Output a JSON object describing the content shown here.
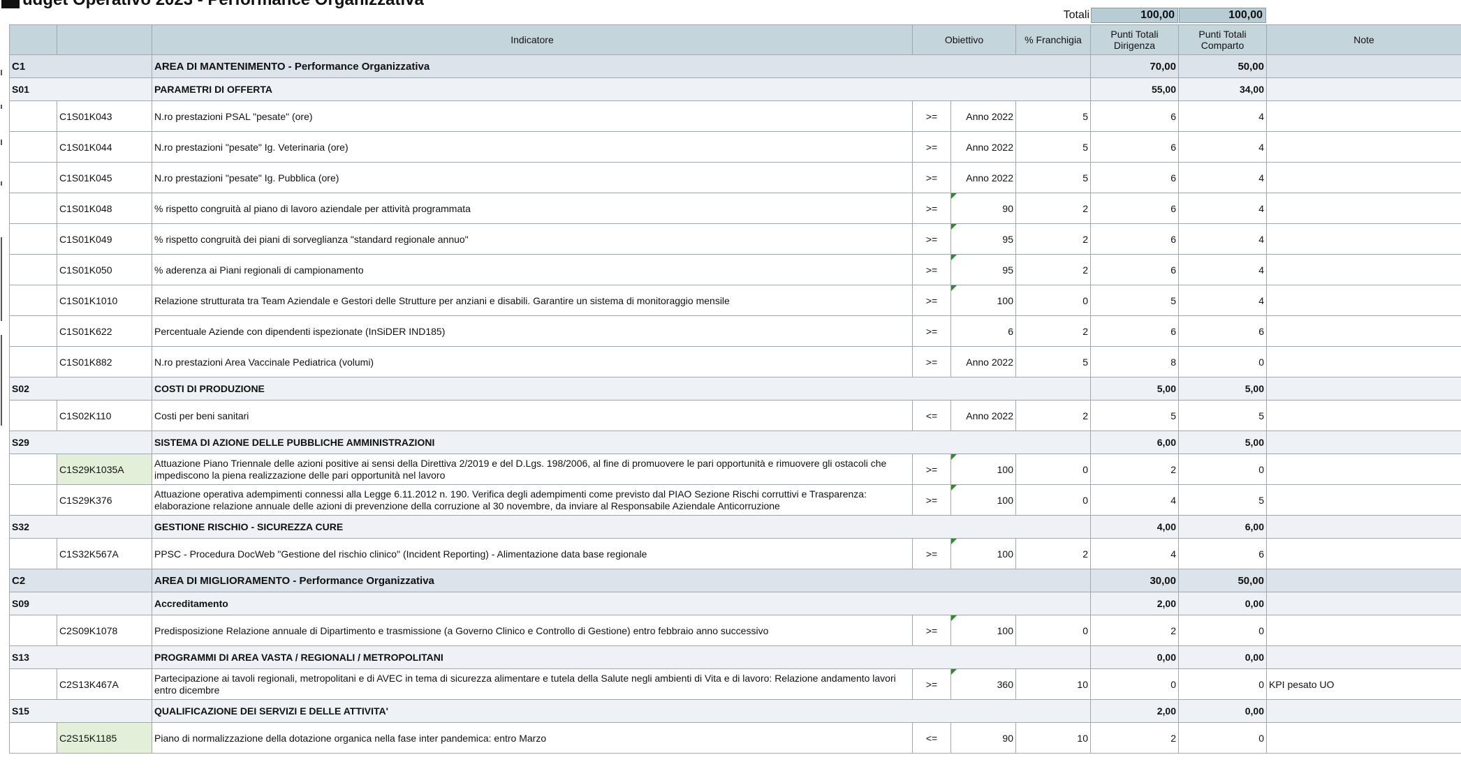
{
  "title": "udget Operativo 2023 - Performance Organizzativa",
  "totals": {
    "label": "Totali",
    "dirigenza": "100,00",
    "comparto": "100,00"
  },
  "headers": {
    "code": "",
    "sub": "",
    "indicatore": "Indicatore",
    "obiettivo": "Obiettivo",
    "franchigia": "% Franchigia",
    "dirigenza": "Punti Totali Dirigenza",
    "comparto": "Punti Totali Comparto",
    "note": "Note"
  },
  "rows": [
    {
      "type": "area",
      "code": "C1",
      "title": "AREA DI MANTENIMENTO - Performance Organizzativa",
      "dir": "70,00",
      "comp": "50,00"
    },
    {
      "type": "sec",
      "code": "S01",
      "title": "PARAMETRI DI OFFERTA",
      "dir": "55,00",
      "comp": "34,00"
    },
    {
      "type": "item",
      "id": "C1S01K043",
      "desc": "N.ro prestazioni PSAL  \"pesate\" (ore)",
      "op": ">=",
      "obj": "Anno 2022",
      "fr": "5",
      "dir": "6",
      "comp": "4",
      "note": "",
      "flag": false,
      "green": false
    },
    {
      "type": "item",
      "id": "C1S01K044",
      "desc": "N.ro prestazioni \"pesate\" Ig. Veterinaria (ore)",
      "op": ">=",
      "obj": "Anno 2022",
      "fr": "5",
      "dir": "6",
      "comp": "4",
      "note": "",
      "flag": false,
      "green": false
    },
    {
      "type": "item",
      "id": "C1S01K045",
      "desc": "N.ro prestazioni \"pesate\" Ig. Pubblica (ore)",
      "op": ">=",
      "obj": "Anno 2022",
      "fr": "5",
      "dir": "6",
      "comp": "4",
      "note": "",
      "flag": false,
      "green": false
    },
    {
      "type": "item",
      "id": "C1S01K048",
      "desc": "% rispetto congruità al piano di lavoro aziendale per attività programmata",
      "op": ">=",
      "obj": "90",
      "fr": "2",
      "dir": "6",
      "comp": "4",
      "note": "",
      "flag": true,
      "green": false
    },
    {
      "type": "item",
      "id": "C1S01K049",
      "desc": "% rispetto congruità dei piani di sorveglianza \"standard regionale annuo\"",
      "op": ">=",
      "obj": "95",
      "fr": "2",
      "dir": "6",
      "comp": "4",
      "note": "",
      "flag": true,
      "green": false
    },
    {
      "type": "item",
      "id": "C1S01K050",
      "desc": "% aderenza ai Piani regionali di campionamento",
      "op": ">=",
      "obj": "95",
      "fr": "2",
      "dir": "6",
      "comp": "4",
      "note": "",
      "flag": true,
      "green": false
    },
    {
      "type": "item",
      "id": "C1S01K1010",
      "desc": "Relazione strutturata tra Team Aziendale e Gestori delle Strutture per anziani e disabili. Garantire un sistema di monitoraggio mensile",
      "op": ">=",
      "obj": "100",
      "fr": "0",
      "dir": "5",
      "comp": "4",
      "note": "",
      "flag": true,
      "green": false
    },
    {
      "type": "item",
      "id": "C1S01K622",
      "desc": "Percentuale Aziende con dipendenti ispezionate (InSiDER IND185)",
      "op": ">=",
      "obj": "6",
      "fr": "2",
      "dir": "6",
      "comp": "6",
      "note": "",
      "flag": false,
      "green": false
    },
    {
      "type": "item",
      "id": "C1S01K882",
      "desc": "N.ro prestazioni Area Vaccinale Pediatrica (volumi)",
      "op": ">=",
      "obj": "Anno 2022",
      "fr": "5",
      "dir": "8",
      "comp": "0",
      "note": "",
      "flag": false,
      "green": false
    },
    {
      "type": "sec",
      "code": "S02",
      "title": "COSTI DI PRODUZIONE",
      "dir": "5,00",
      "comp": "5,00"
    },
    {
      "type": "item",
      "id": "C1S02K110",
      "desc": "Costi per beni sanitari",
      "op": "<=",
      "obj": "Anno 2022",
      "fr": "2",
      "dir": "5",
      "comp": "5",
      "note": "",
      "flag": false,
      "green": false
    },
    {
      "type": "sec",
      "code": "S29",
      "title": "SISTEMA DI AZIONE DELLE PUBBLICHE AMMINISTRAZIONI",
      "dir": "6,00",
      "comp": "5,00"
    },
    {
      "type": "item",
      "id": "C1S29K1035A",
      "desc": "Attuazione Piano Triennale delle azioni positive ai sensi della Direttiva 2/2019 e del D.Lgs. 198/2006, al fine di promuovere le pari opportunità e rimuovere gli ostacoli che impediscono la piena realizzazione delle pari opportunità nel lavoro",
      "op": ">=",
      "obj": "100",
      "fr": "0",
      "dir": "2",
      "comp": "0",
      "note": "",
      "flag": true,
      "green": true,
      "wrap": true
    },
    {
      "type": "item",
      "id": "C1S29K376",
      "desc": "Attuazione operativa adempimenti connessi alla Legge 6.11.2012 n. 190. Verifica degli adempimenti come previsto dal PIAO Sezione Rischi corruttivi e Trasparenza: elaborazione relazione annuale delle azioni di prevenzione della corruzione al 30 novembre, da inviare al Responsabile Aziendale Anticorruzione",
      "op": ">=",
      "obj": "100",
      "fr": "0",
      "dir": "4",
      "comp": "5",
      "note": "",
      "flag": true,
      "green": false,
      "wrap": true
    },
    {
      "type": "sec",
      "code": "S32",
      "title": "GESTIONE RISCHIO - SICUREZZA CURE",
      "dir": "4,00",
      "comp": "6,00"
    },
    {
      "type": "item",
      "id": "C1S32K567A",
      "desc": "PPSC - Procedura  DocWeb \"Gestione del rischio clinico\" (Incident Reporting) - Alimentazione data base regionale",
      "op": ">=",
      "obj": "100",
      "fr": "2",
      "dir": "4",
      "comp": "6",
      "note": "",
      "flag": true,
      "green": false
    },
    {
      "type": "area",
      "code": "C2",
      "title": "AREA DI MIGLIORAMENTO - Performance Organizzativa",
      "dir": "30,00",
      "comp": "50,00"
    },
    {
      "type": "sec",
      "code": "S09",
      "title": "Accreditamento",
      "dir": "2,00",
      "comp": "0,00"
    },
    {
      "type": "item",
      "id": "C2S09K1078",
      "desc": "Predisposizione Relazione annuale di Dipartimento e trasmissione (a Governo Clinico e Controllo di Gestione) entro febbraio anno successivo",
      "op": ">=",
      "obj": "100",
      "fr": "0",
      "dir": "2",
      "comp": "0",
      "note": "",
      "flag": true,
      "green": false
    },
    {
      "type": "sec",
      "code": "S13",
      "title": "PROGRAMMI DI AREA VASTA  / REGIONALI / METROPOLITANI",
      "dir": "0,00",
      "comp": "0,00"
    },
    {
      "type": "item",
      "id": "C2S13K467A",
      "desc": "Partecipazione ai tavoli regionali, metropolitani e di AVEC in tema di sicurezza alimentare e tutela della Salute negli ambienti di Vita e di lavoro: Relazione andamento lavori entro dicembre",
      "op": ">=",
      "obj": "360",
      "fr": "10",
      "dir": "0",
      "comp": "0",
      "note": "KPI pesato UO",
      "flag": true,
      "green": false,
      "wrap": true
    },
    {
      "type": "sec",
      "code": "S15",
      "title": "QUALIFICAZIONE DEI SERVIZI E DELLE ATTIVITA'",
      "dir": "2,00",
      "comp": "0,00"
    },
    {
      "type": "item",
      "id": "C2S15K1185",
      "desc": "Piano di normalizzazione della dotazione organica nella fase inter pandemica: entro Marzo",
      "op": "<=",
      "obj": "90",
      "fr": "10",
      "dir": "2",
      "comp": "0",
      "note": "",
      "flag": false,
      "green": true
    }
  ]
}
